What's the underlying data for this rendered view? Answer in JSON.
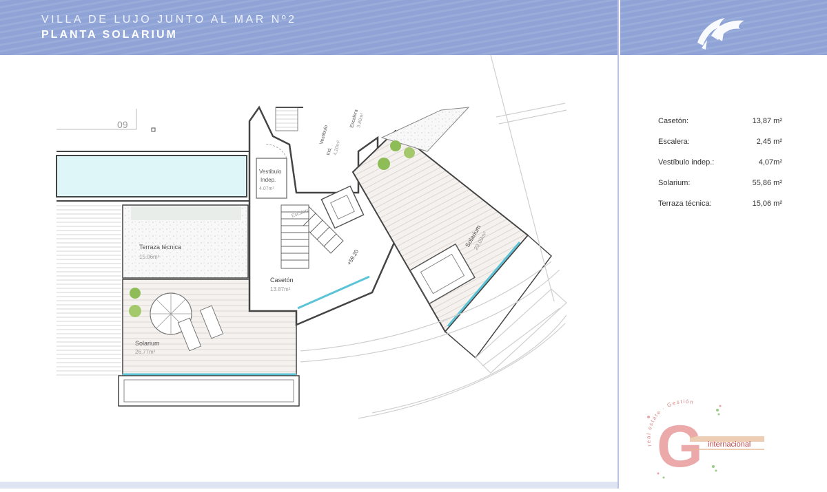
{
  "header": {
    "title": "VILLA DE LUJO JUNTO AL MAR Nº2",
    "subtitle": "PLANTA SOLARIUM"
  },
  "plan": {
    "unit_number": "09",
    "labels": {
      "vestibulo_left_name": "Vestibulo",
      "vestibulo_left_name2": "Indep.",
      "vestibulo_left_area": "4.07m²",
      "vestibulo_top_name": "Vestibulo",
      "vestibulo_top_name2": "Ind.",
      "vestibulo_top_area": "4.20m²",
      "escalera_name": "Escalera",
      "escalera_area": "3.80m²",
      "escalera_inner": "Escalera",
      "terraza_name": "Terraza técnica",
      "terraza_area": "15.06m²",
      "caseton_name": "Casetón",
      "caseton_area": "13.87m²",
      "level": "+59.20",
      "solarium_left_name": "Solarium",
      "solarium_left_area": "26.77m²",
      "solarium_right_name": "Solarium",
      "solarium_right_area": "29.09m²"
    }
  },
  "areas": [
    {
      "name": "Casetón:",
      "value": "13,87 m²"
    },
    {
      "name": "Escalera:",
      "value": "2,45 m²"
    },
    {
      "name": "Vestíbulo indep.:",
      "value": "4,07m²"
    },
    {
      "name": "Solarium:",
      "value": "55,86 m²"
    },
    {
      "name": "Terraza técnica:",
      "value": "15,06  m²"
    }
  ],
  "brand": {
    "name": "internacional",
    "arc_text": "real estate · Gestión",
    "colors": {
      "red": "#e8a6a6",
      "green": "#9ccb86",
      "accent": "#8fa3d6"
    }
  }
}
